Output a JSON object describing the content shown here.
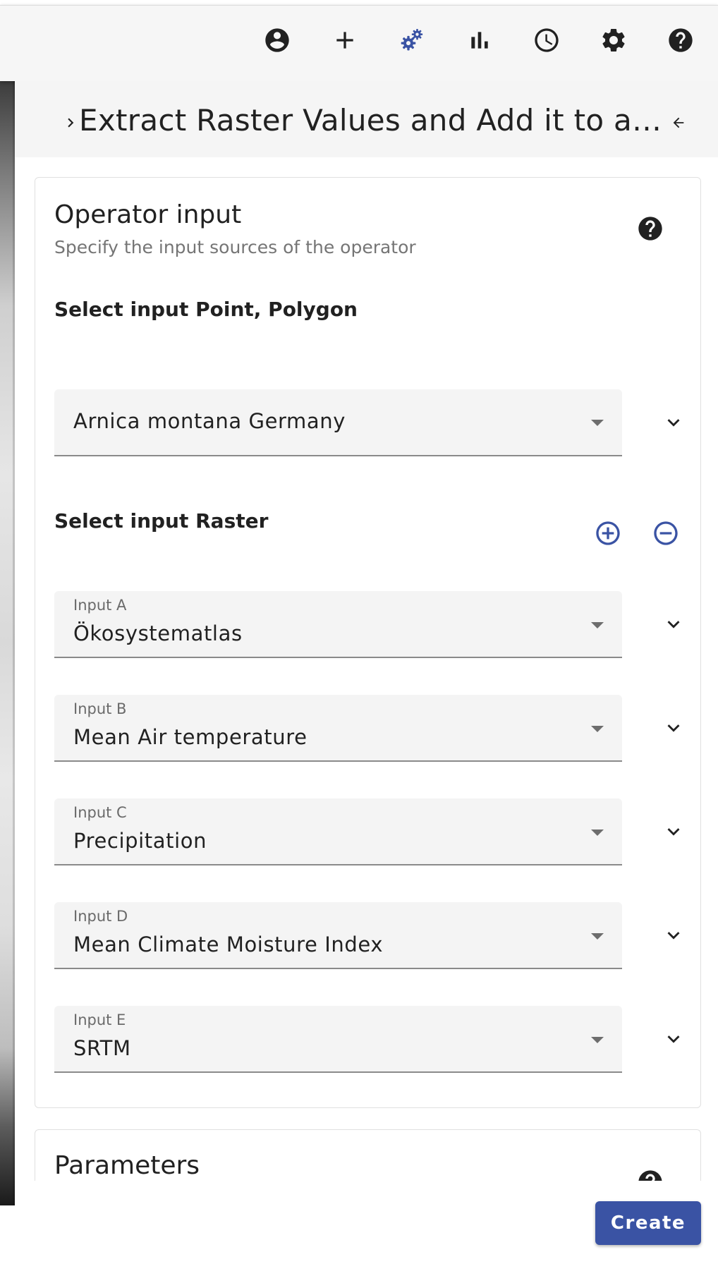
{
  "toolbar": {
    "icons": [
      "account-circle-icon",
      "add-icon",
      "workflow-gears-icon",
      "bar-chart-icon",
      "clock-icon",
      "settings-icon",
      "help-icon"
    ],
    "active_color": "#3a53a4",
    "icon_color": "#212121"
  },
  "header": {
    "title": "Extract Raster Values and Add it to a Vector Layer"
  },
  "operator_input": {
    "title": "Operator input",
    "subtitle": "Specify the input sources of the operator",
    "vector_section_label": "Select input Point, Polygon",
    "vector_value": "Arnica montana Germany",
    "raster_section_label": "Select input Raster",
    "rasters": [
      {
        "label": "Input A",
        "value": "Ökosystematlas"
      },
      {
        "label": "Input B",
        "value": "Mean Air temperature"
      },
      {
        "label": "Input C",
        "value": "Precipitation"
      },
      {
        "label": "Input D",
        "value": "Mean Climate Moisture Index"
      },
      {
        "label": "Input E",
        "value": "SRTM"
      }
    ]
  },
  "parameters": {
    "title": "Parameters"
  },
  "actions": {
    "create_label": "Create"
  },
  "colors": {
    "primary": "#3a53a4",
    "field_bg": "#f4f4f4",
    "header_bg": "#f5f5f5"
  }
}
